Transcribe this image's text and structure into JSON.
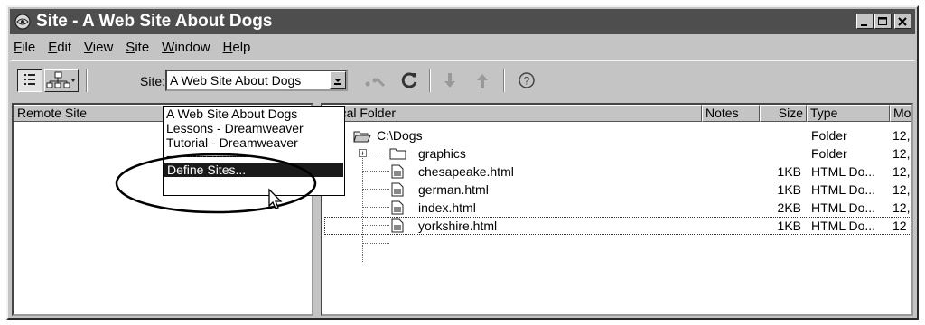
{
  "window": {
    "title": "Site - A Web Site About Dogs"
  },
  "menu": {
    "items": [
      {
        "acc": "F",
        "rest": "ile"
      },
      {
        "acc": "E",
        "rest": "dit"
      },
      {
        "acc": "V",
        "rest": "iew"
      },
      {
        "acc": "S",
        "rest": "ite"
      },
      {
        "acc": "W",
        "rest": "indow"
      },
      {
        "acc": "H",
        "rest": "elp"
      }
    ]
  },
  "toolbar": {
    "site_label": "Site:",
    "site_value": "A Web Site About Dogs"
  },
  "site_dropdown": {
    "options": [
      "A Web Site About Dogs",
      "Lessons - Dreamweaver",
      "Tutorial - Dreamweaver"
    ],
    "separator": "--------------------------",
    "define_sites": "Define Sites..."
  },
  "remote_pane": {
    "header": "Remote Site"
  },
  "local_pane": {
    "headers": {
      "folder": "Local Folder",
      "notes": "Notes",
      "size": "Size",
      "type": "Type",
      "modified": "Mo"
    },
    "rows": [
      {
        "name": "C:\\Dogs",
        "size": "",
        "type": "Folder",
        "mod": "12,"
      },
      {
        "name": "graphics",
        "size": "",
        "type": "Folder",
        "mod": "12,"
      },
      {
        "name": "chesapeake.html",
        "size": "1KB",
        "type": "HTML Do...",
        "mod": "12,"
      },
      {
        "name": "german.html",
        "size": "1KB",
        "type": "HTML Do...",
        "mod": "12,"
      },
      {
        "name": "index.html",
        "size": "2KB",
        "type": "HTML Do...",
        "mod": "12,"
      },
      {
        "name": "yorkshire.html",
        "size": "1KB",
        "type": "HTML Do...",
        "mod": "12"
      }
    ]
  }
}
